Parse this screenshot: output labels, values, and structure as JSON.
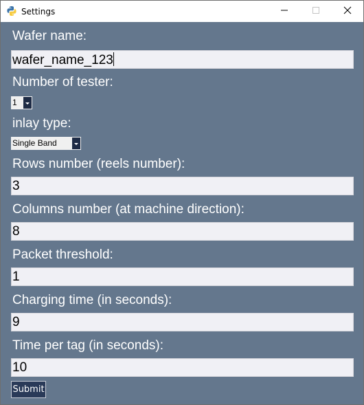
{
  "window": {
    "title": "Settings"
  },
  "form": {
    "wafer_name": {
      "label": "Wafer name:",
      "value": "wafer_name_123"
    },
    "num_tester": {
      "label": "Number of tester:",
      "value": "1"
    },
    "inlay_type": {
      "label": "inlay type:",
      "value": "Single Band"
    },
    "rows": {
      "label": "Rows number (reels number):",
      "value": "3"
    },
    "columns": {
      "label": "Columns number (at machine direction):",
      "value": "8"
    },
    "packet_threshold": {
      "label": "Packet threshold:",
      "value": "1"
    },
    "charging_time": {
      "label": "Charging time (in seconds):",
      "value": "9"
    },
    "time_per_tag": {
      "label": "Time per tag (in seconds):",
      "value": "10"
    },
    "submit_label": "Submit"
  },
  "colors": {
    "background": "#64778d",
    "field": "#f0f0f5",
    "button": "#2a3a58",
    "combo_arrow": "#1e2b45"
  },
  "icons": {
    "app": "python-icon",
    "minimize": "minimize-icon",
    "maximize": "maximize-icon",
    "close": "close-icon"
  }
}
